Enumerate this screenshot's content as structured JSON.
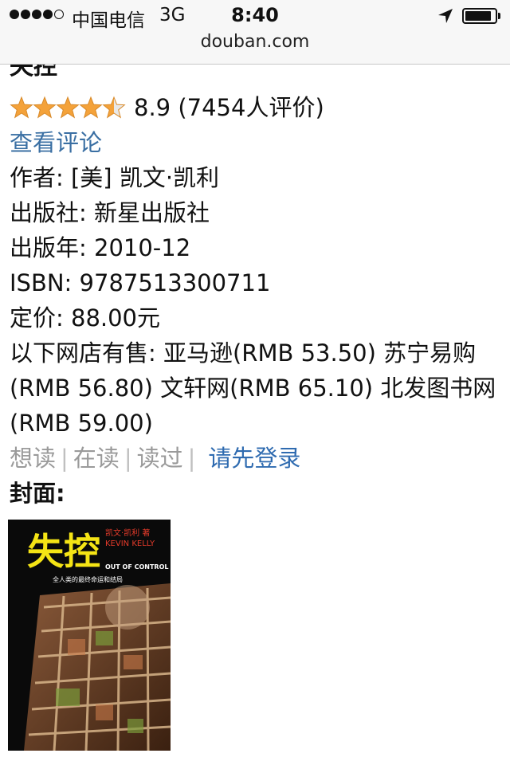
{
  "status_bar": {
    "carrier": "中国电信",
    "network": "3G",
    "time": "8:40",
    "battery_level": 0.9
  },
  "browser": {
    "url": "douban.com"
  },
  "book": {
    "title": "失控",
    "rating_stars": 4.5,
    "rating_text": "8.9 (7454人评价)",
    "review_link": "查看评论",
    "author": "作者: [美] 凯文·凯利",
    "publisher": "出版社: 新星出版社",
    "pub_year": "出版年: 2010-12",
    "isbn": "ISBN: 9787513300711",
    "price": "定价: 88.00元",
    "stores": "以下网店有售: 亚马逊(RMB 53.50) 苏宁易购(RMB 56.80) 文轩网(RMB 65.10) 北发图书网(RMB 59.00)"
  },
  "actions": {
    "want_read": "想读",
    "reading": "在读",
    "read": "读过",
    "separator": "|",
    "login": "请先登录"
  },
  "cover": {
    "label": "封面:",
    "title_text": "失控",
    "author_cn": "凯文·凯利 著",
    "author_en": "KEVIN KELLY",
    "subtitle_en": "OUT OF CONTROL",
    "tagline": "全人类的最终命运和结局",
    "accent_color": "#f5e415"
  }
}
